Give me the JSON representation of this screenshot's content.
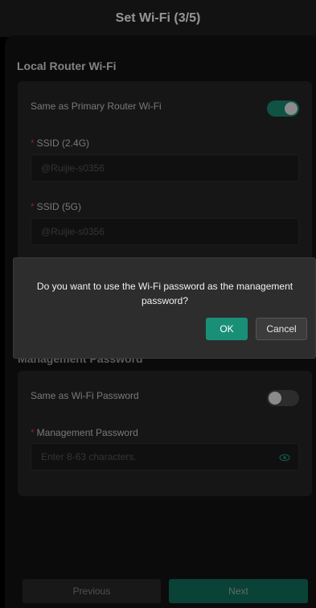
{
  "header": {
    "title": "Set Wi-Fi (3/5)"
  },
  "local_wifi": {
    "section_title": "Local Router Wi-Fi",
    "same_as_primary_label": "Same as Primary Router Wi-Fi",
    "same_as_primary_on": true,
    "ssid_24_label": "SSID (2.4G)",
    "ssid_24_value": "@Ruijie-s0356",
    "ssid_5_label": "SSID (5G)",
    "ssid_5_value": "@Ruijie-s0356"
  },
  "management": {
    "section_title": "Management Password",
    "same_as_wifi_label": "Same as Wi-Fi Password",
    "same_as_wifi_on": false,
    "password_label": "Management Password",
    "password_placeholder": "Enter 8-63 characters."
  },
  "dialog": {
    "message": "Do you want to use the Wi-Fi password as the management password?",
    "ok_label": "OK",
    "cancel_label": "Cancel"
  },
  "footer": {
    "previous_label": "Previous",
    "next_label": "Next"
  },
  "colors": {
    "accent": "#1a8f78",
    "required": "#e33b3b"
  }
}
